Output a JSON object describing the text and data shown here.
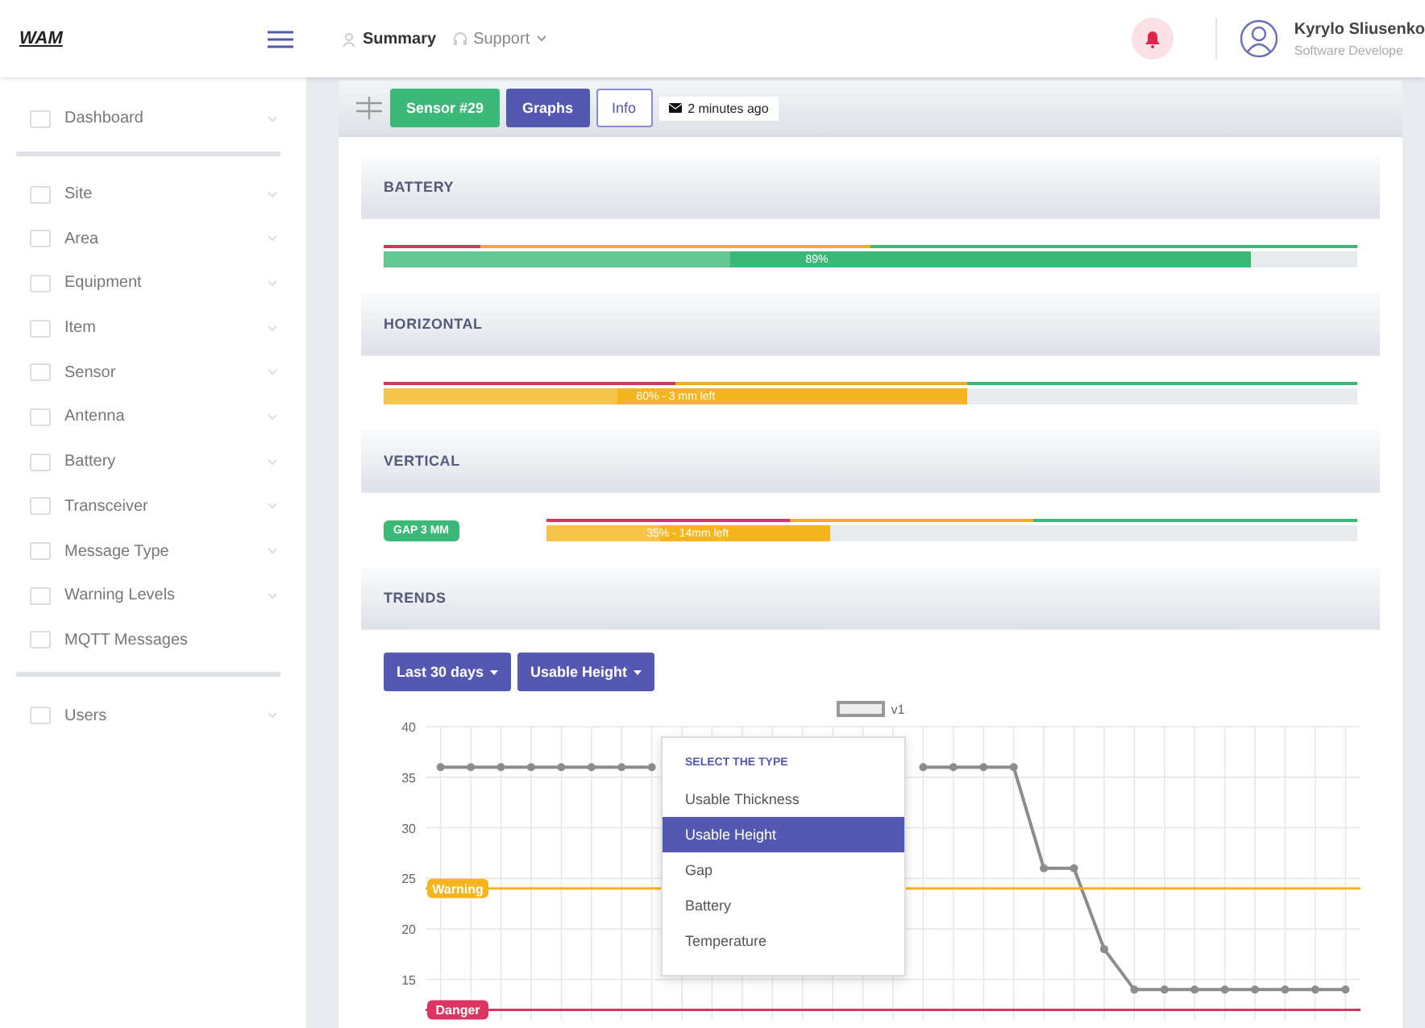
{
  "header": {
    "logo": "WAM",
    "nav": [
      {
        "label": "Summary",
        "kind": "link"
      },
      {
        "label": "Support",
        "kind": "dropdown"
      }
    ],
    "user": {
      "name": "Kyrylo Sliusenko",
      "role": "Software Develope"
    }
  },
  "sidebar": {
    "groups": [
      [
        {
          "label": "Dashboard",
          "expandable": true
        }
      ],
      [
        {
          "label": "Site",
          "expandable": true
        },
        {
          "label": "Area",
          "expandable": true
        },
        {
          "label": "Equipment",
          "expandable": true
        },
        {
          "label": "Item",
          "expandable": true
        },
        {
          "label": "Sensor",
          "expandable": true
        },
        {
          "label": "Antenna",
          "expandable": true
        },
        {
          "label": "Battery",
          "expandable": true
        },
        {
          "label": "Transceiver",
          "expandable": true
        },
        {
          "label": "Message Type",
          "expandable": true
        },
        {
          "label": "Warning Levels",
          "expandable": true
        },
        {
          "label": "MQTT Messages",
          "expandable": false
        }
      ],
      [
        {
          "label": "Users",
          "expandable": true
        }
      ]
    ]
  },
  "toolbar": {
    "buttons": [
      {
        "label": "Sensor #29",
        "kind": "success"
      },
      {
        "label": "Graphs",
        "kind": "primary"
      },
      {
        "label": "Info",
        "kind": "outline"
      }
    ],
    "last_message": "2 minutes ago"
  },
  "sections": [
    {
      "title": "BATTERY",
      "level": 0.89,
      "reading": "89%",
      "color": "#3cb878",
      "threshold": {
        "color": "#3cb878",
        "zones": [
          {
            "color": "#f2b01e",
            "level": 0.5
          },
          {
            "color": "#d9345a",
            "level": 0.1
          }
        ]
      }
    },
    {
      "title": "HORIZONTAL",
      "level": 0.6,
      "reading": "60% - 3 mm left",
      "color": "#f5b51f",
      "threshold": {
        "color": "#3cb878",
        "zones": [
          {
            "color": "#f2b01e",
            "level": 0.6
          },
          {
            "color": "#d9345a",
            "level": 0.3
          }
        ]
      }
    },
    {
      "title": "VERTICAL",
      "badge": "GAP 3 MM",
      "level": 0.35,
      "reading": "35% - 14mm left",
      "color": "#f5b51f",
      "threshold": {
        "color": "#3cb878",
        "zones": [
          {
            "color": "#f2b01e",
            "level": 0.6
          },
          {
            "color": "#d9345a",
            "level": 0.3
          }
        ]
      }
    }
  ],
  "trends": {
    "title": "TRENDS",
    "filters": [
      {
        "label": "Last 30 days"
      },
      {
        "label": "Usable Height"
      }
    ],
    "menu": {
      "heading": "SELECT THE TYPE",
      "options": [
        {
          "label": "Usable Thickness",
          "selected": false
        },
        {
          "label": "Usable Height",
          "selected": true
        },
        {
          "label": "Gap",
          "selected": false
        },
        {
          "label": "Battery",
          "selected": false
        },
        {
          "label": "Temperature",
          "selected": false
        }
      ]
    },
    "chart_data": {
      "type": "line",
      "ylim": [
        11,
        40
      ],
      "yticks": [
        15,
        20,
        25,
        30,
        35,
        40
      ],
      "grid": true,
      "series": [
        {
          "name": "v1",
          "color": "#8c8c8c",
          "marker": true,
          "values": [
            36,
            36,
            36,
            36,
            36,
            36,
            36,
            36,
            null,
            null,
            null,
            null,
            null,
            null,
            null,
            null,
            36,
            36,
            36,
            36,
            26,
            26,
            18,
            14,
            14,
            14,
            14,
            14,
            14,
            14,
            14
          ]
        }
      ],
      "ref_lines": [
        {
          "axis": "y",
          "value": 24,
          "label": "Warning",
          "color": "#f5b51f"
        },
        {
          "axis": "y",
          "value": 12,
          "label": "Danger",
          "color": "#dc3561"
        }
      ]
    }
  }
}
